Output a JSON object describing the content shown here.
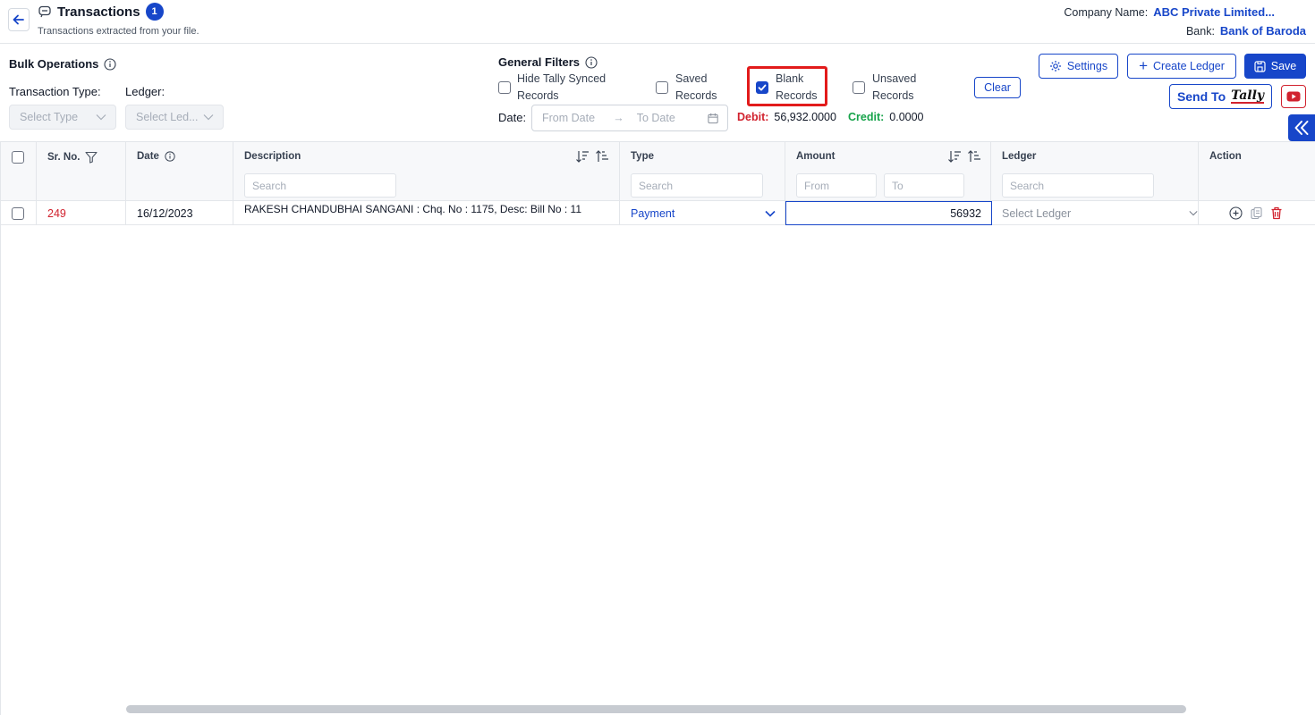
{
  "header": {
    "title": "Transactions",
    "count": "1",
    "subtitle": "Transactions extracted from your file.",
    "company_label": "Company Name:",
    "company_value": "ABC Private Limited...",
    "bank_label": "Bank:",
    "bank_value": "Bank of Baroda"
  },
  "bulk": {
    "title": "Bulk Operations",
    "type_label": "Transaction Type:",
    "ledger_label": "Ledger:",
    "type_placeholder": "Select Type",
    "ledger_placeholder": "Select Led..."
  },
  "filters": {
    "title": "General Filters",
    "options": [
      {
        "line1": "Hide Tally Synced",
        "line2": "Records",
        "checked": false
      },
      {
        "line1": "Saved",
        "line2": "Records",
        "checked": false
      },
      {
        "line1": "Blank",
        "line2": "Records",
        "checked": true
      },
      {
        "line1": "Unsaved",
        "line2": "Records",
        "checked": false
      }
    ],
    "clear_label": "Clear",
    "date_label": "Date:",
    "from_placeholder": "From Date",
    "to_placeholder": "To Date",
    "debit_label": "Debit:",
    "debit_value": "56,932.0000",
    "credit_label": "Credit:",
    "credit_value": "0.0000"
  },
  "toolbar": {
    "settings_label": "Settings",
    "create_ledger_label": "Create Ledger",
    "save_label": "Save",
    "send_to_label": "Send To",
    "tally_logo_text": "Tally"
  },
  "table": {
    "columns": {
      "sr_no": "Sr. No.",
      "date": "Date",
      "description": "Description",
      "type": "Type",
      "amount": "Amount",
      "ledger": "Ledger",
      "action": "Action"
    },
    "search_placeholder": "Search",
    "amount_from": "From",
    "amount_to": "To",
    "rows": [
      {
        "sr_no": "249",
        "date": "16/12/2023",
        "description": "RAKESH CHANDUBHAI SANGANI : Chq. No : 1175, Desc: Bill No : 11",
        "type": "Payment",
        "amount": "56932",
        "ledger_placeholder": "Select Ledger"
      }
    ]
  },
  "colors": {
    "primary": "#1746c9",
    "debit": "#d1222e",
    "credit": "#16a34a",
    "highlight": "#e21b1b"
  }
}
